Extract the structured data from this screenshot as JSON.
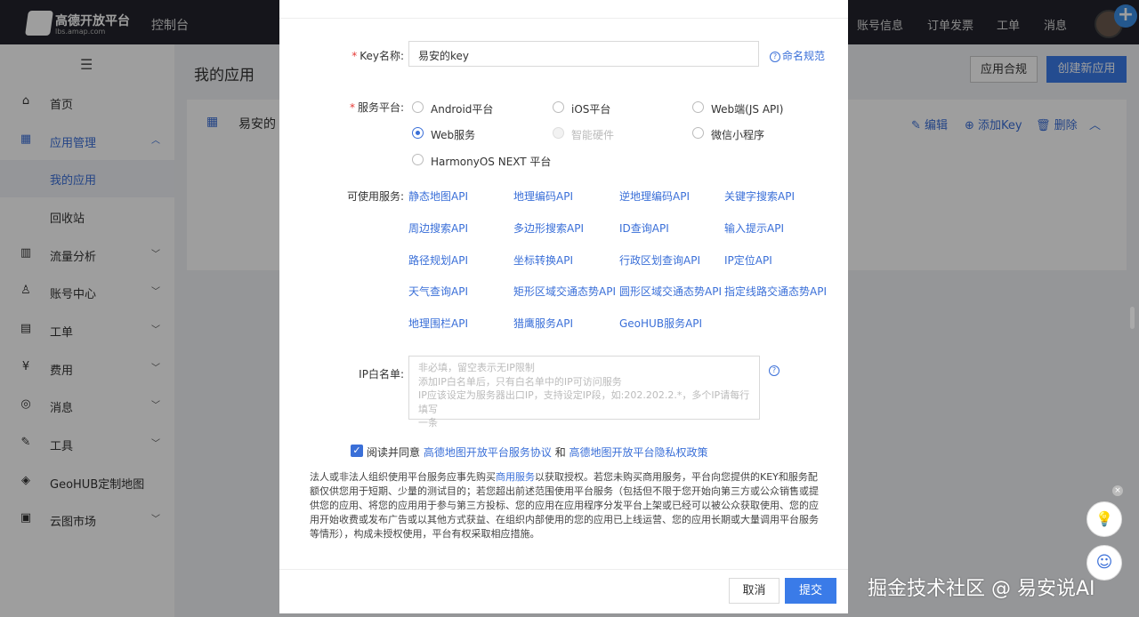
{
  "topbar": {
    "logo_title": "高德开放平台",
    "logo_sub": "lbs.amap.com",
    "console": "控制台",
    "nav": [
      "账号信息",
      "订单发票",
      "工单",
      "消息"
    ]
  },
  "sidebar": {
    "items": [
      {
        "label": "首页",
        "icon": "home-icon"
      },
      {
        "label": "应用管理",
        "icon": "grid-icon"
      },
      {
        "label": "我的应用"
      },
      {
        "label": "回收站"
      },
      {
        "label": "流量分析",
        "icon": "chart-icon"
      },
      {
        "label": "账号中心",
        "icon": "user-icon"
      },
      {
        "label": "工单",
        "icon": "ticket-icon"
      },
      {
        "label": "费用",
        "icon": "money-icon"
      },
      {
        "label": "消息",
        "icon": "message-icon"
      },
      {
        "label": "工具",
        "icon": "wrench-icon"
      },
      {
        "label": "GeoHUB定制地图",
        "icon": "layers-icon"
      },
      {
        "label": "云图市场",
        "icon": "store-icon"
      }
    ]
  },
  "main": {
    "title": "我的应用",
    "compliance_button": "应用合规",
    "create_button": "创建新应用",
    "app_name": "易安的",
    "actions": {
      "edit": "编辑",
      "add_key": "添加Key",
      "delete": "删除"
    }
  },
  "modal": {
    "key_name_label": "Key名称:",
    "key_name_value": "易安的key",
    "naming_rule": "命名规范",
    "platform_label": "服务平台:",
    "platforms": [
      "Android平台",
      "iOS平台",
      "Web端(JS API)",
      "Web服务",
      "智能硬件",
      "微信小程序",
      "HarmonyOS NEXT 平台"
    ],
    "selected_platform": "Web服务",
    "services_label": "可使用服务:",
    "services": [
      "静态地图API",
      "地理编码API",
      "逆地理编码API",
      "关键字搜索API",
      "周边搜索API",
      "多边形搜索API",
      "ID查询API",
      "输入提示API",
      "路径规划API",
      "坐标转换API",
      "行政区划查询API",
      "IP定位API",
      "天气查询API",
      "矩形区域交通态势API",
      "圆形区域交通态势API",
      "指定线路交通态势API",
      "地理围栏API",
      "猎鹰服务API",
      "GeoHUB服务API"
    ],
    "ip_label": "IP白名单:",
    "ip_placeholder_lines": [
      "非必填，留空表示无IP限制",
      "添加IP白名单后，只有白名单中的IP可访问服务",
      "IP应该设定为服务器出口IP，支持设定IP段，如:202.202.2.*，多个IP请每行填写",
      "一条"
    ],
    "agree_prefix": "阅读并同意",
    "agree_link1": "高德地图开放平台服务协议",
    "agree_and": "和",
    "agree_link2": "高德地图开放平台隐私权政策",
    "legal_part1": "法人或非法人组织使用平台服务应事先购买",
    "legal_link": "商用服务",
    "legal_part2": "以获取授权。若您未购买商用服务，平台向您提供的KEY和服务配额仅供您用于短期、少量的测试目的；若您超出前述范围使用平台服务（包括但不限于您开始向第三方或公众销售或提供您的应用、将您的应用用于参与第三方投标、您的应用在应用程序分发平台上架或已经可以被公众获取使用、您的应用开始收费或发布广告或以其他方式获益、在组织内部使用的您的应用已上线运营、您的应用长期或大量调用平台服务等情形），构成未授权使用，平台有权采取相应措施。",
    "cancel": "取消",
    "submit": "提交"
  },
  "watermark": "掘金技术社区 @ 易安说AI",
  "colors": {
    "accent": "#3a7be8",
    "topbar": "#22232c",
    "required": "#e53935"
  }
}
